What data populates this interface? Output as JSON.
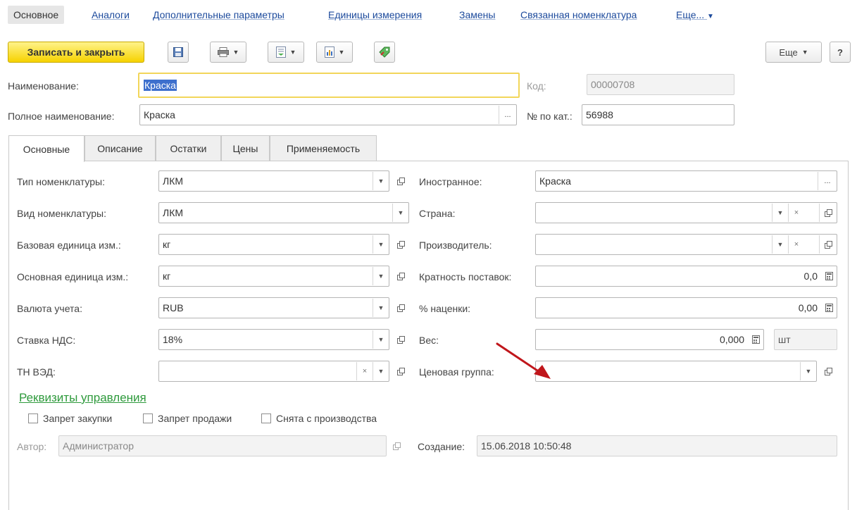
{
  "nav": {
    "active": "Основное",
    "links": [
      "Аналоги",
      "Дополнительные параметры",
      "Единицы измерения",
      "Замены",
      "Связанная номенклатура",
      "Еще..."
    ]
  },
  "toolbar": {
    "save_close_label": "Записать и закрыть",
    "more_label": "Еще",
    "help_label": "?"
  },
  "header": {
    "name_label": "Наименование:",
    "name_value": "Краска",
    "code_label": "Код:",
    "code_value": "00000708",
    "full_name_label": "Полное наименование:",
    "full_name_value": "Краска",
    "catalog_label": "№ по кат.:",
    "catalog_value": "56988",
    "ellipsis": "..."
  },
  "tabs": [
    "Основные",
    "Описание",
    "Остатки",
    "Цены",
    "Применяемость"
  ],
  "left": {
    "nomenclature_type": {
      "label": "Тип номенклатуры:",
      "value": "ЛКМ"
    },
    "nomenclature_kind": {
      "label": "Вид номенклатуры:",
      "value": "ЛКМ"
    },
    "base_unit": {
      "label": "Базовая единица изм.:",
      "value": "кг"
    },
    "main_unit": {
      "label": "Основная единица изм.:",
      "value": "кг"
    },
    "currency": {
      "label": "Валюта учета:",
      "value": "RUB"
    },
    "vat_rate": {
      "label": "Ставка НДС:",
      "value": "18%"
    },
    "tn_ved": {
      "label": "ТН ВЭД:",
      "value": ""
    }
  },
  "right": {
    "foreign": {
      "label": "Иностранное:",
      "value": "Краска"
    },
    "country": {
      "label": "Страна:",
      "value": ""
    },
    "manufacturer": {
      "label": "Производитель:",
      "value": ""
    },
    "delivery_multiple": {
      "label": "Кратность поставок:",
      "value": "0,0"
    },
    "markup": {
      "label": "% наценки:",
      "value": "0,00"
    },
    "weight": {
      "label": "Вес:",
      "value": "0,000",
      "unit": "шт"
    },
    "price_group": {
      "label": "Ценовая группа:",
      "value": ""
    }
  },
  "management": {
    "title": "Реквизиты управления",
    "checkboxes": [
      {
        "label": "Запрет закупки",
        "checked": false
      },
      {
        "label": "Запрет продажи",
        "checked": false
      },
      {
        "label": "Снята с производства",
        "checked": false
      }
    ],
    "author_label": "Автор:",
    "author_value": "Администратор",
    "created_label": "Создание:",
    "created_value": "15.06.2018 10:50:48"
  },
  "colors": {
    "accent_yellow": "#f6d200",
    "link_blue": "#1c4a9c",
    "group_green": "#2e9a3c",
    "arrow_red": "#c0161b"
  }
}
